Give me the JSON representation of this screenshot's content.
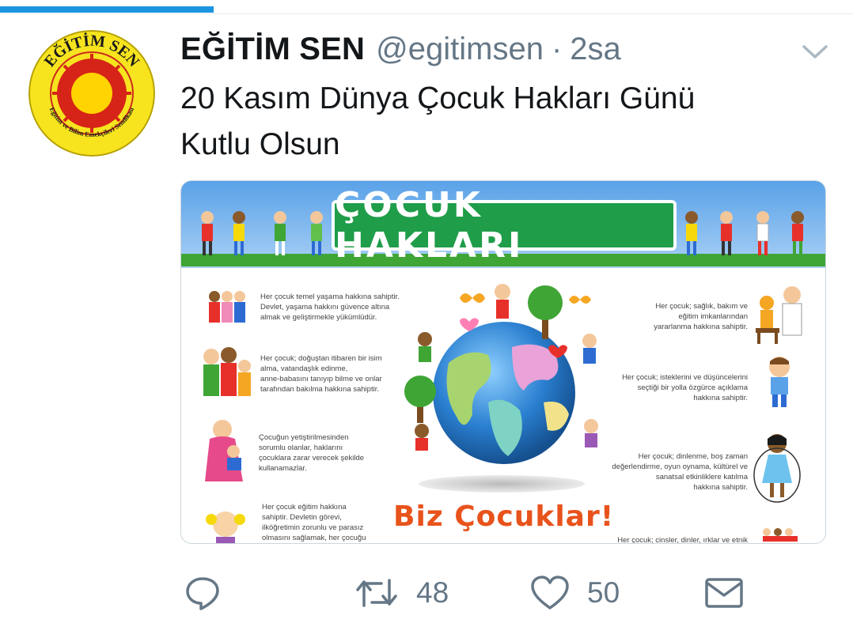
{
  "tweet": {
    "display_name": "EĞİTİM SEN",
    "handle": "@egitimsen",
    "separator": "·",
    "time": "2sa",
    "text_line1": "20 Kasım Dünya Çocuk Hakları Günü",
    "text_line2": "Kutlu Olsun"
  },
  "avatar": {
    "ring_text_top": "EĞİTİM SEN",
    "ring_text_bottom": "Eğitim ve Bilim Emekçileri Sendikası"
  },
  "media": {
    "banner_title": "ÇOCUK HAKLARI",
    "bottom_title": "Biz Çocuklar!",
    "left_items": [
      [
        "Her çocuk temel yaşama hakkına sahiptir.",
        "Devlet, yaşama hakkını güvence altına",
        "almak ve geliştirmekle yükümlüdür."
      ],
      [
        "Her çocuk; doğuştan itibaren bir isim",
        "alma, vatandaşlık edinme,",
        "anne-babasını tanıyıp bilme ve onlar",
        "tarafından bakılma hakkına sahiptir."
      ],
      [
        "Çocuğun yetiştirilmesinden",
        "sorumlu olanlar, haklarını",
        "çocuklara zarar verecek şekilde",
        "kullanamazlar."
      ],
      [
        "Her çocuk eğitim hakkına",
        "sahiptir. Devletin görevi,",
        "ilköğretimin zorunlu ve parasız",
        "olmasını sağlamak, her çocuğu"
      ]
    ],
    "right_items": [
      [
        "Her çocuk;  sağlık, bakım ve",
        "eğitim imkanlarından",
        "yararlanma hakkına sahiptir."
      ],
      [
        "Her çocuk; isteklerini ve düşüncelerini",
        "seçtiği bir yolla özgürce açıklama",
        "hakkına sahiptir."
      ],
      [
        "Her çocuk; dinlenme, boş zaman",
        "değerlendirme, oyun oynama, kültürel ve",
        "sanatsal etkinliklere katılma",
        "hakkına sahiptir."
      ],
      [
        "Her çocuk; cinsler, dinler, ırklar ve etnik"
      ]
    ]
  },
  "actions": {
    "retweet_count": "48",
    "like_count": "50"
  },
  "colors": {
    "accent": "#1b95e0",
    "banner_green": "#1f9d49",
    "orange": "#e8531c",
    "secondary_text": "#657786"
  },
  "progress": {
    "fraction": 0.25
  }
}
